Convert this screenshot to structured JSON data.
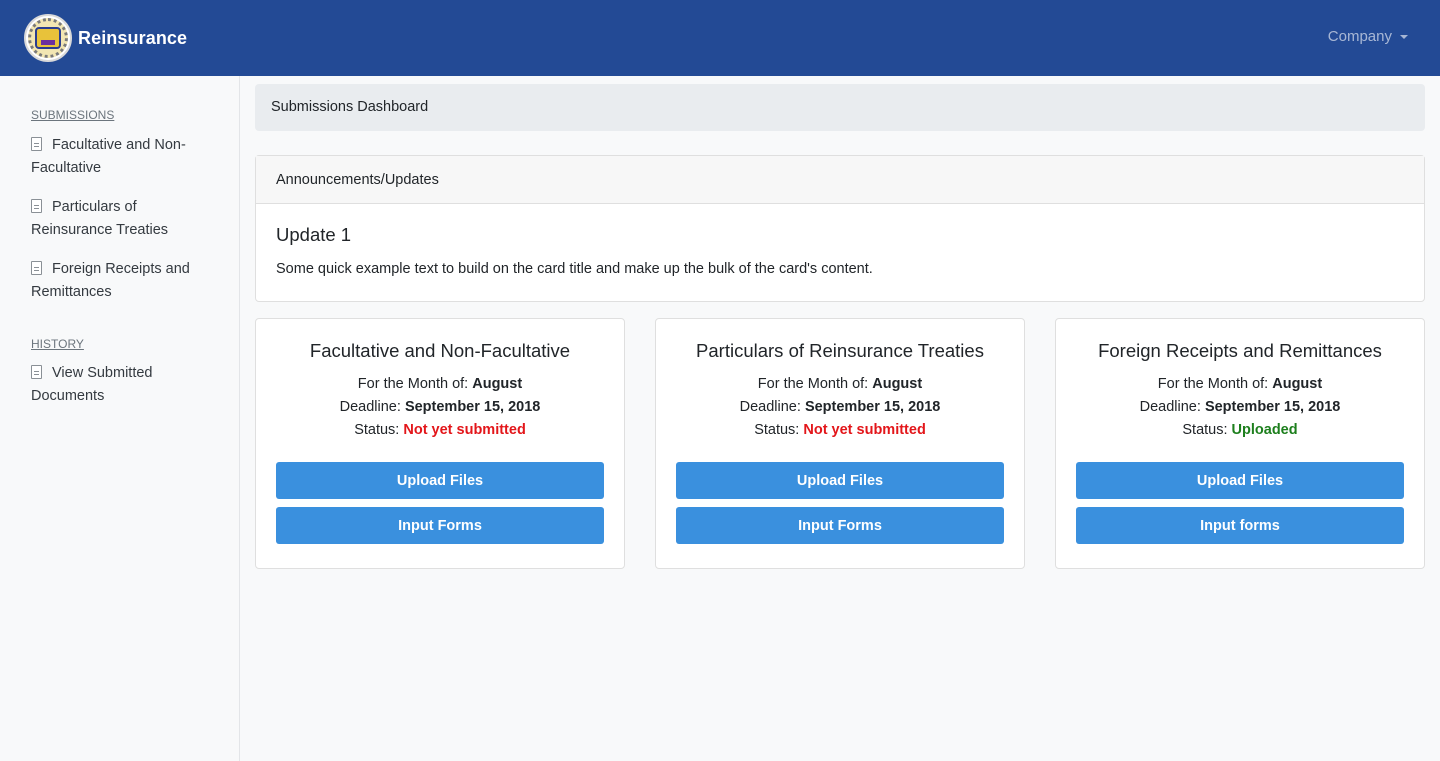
{
  "navbar": {
    "brand": "Reinsurance",
    "logo_icon": "seal-logo",
    "company_menu": "Company",
    "background": "#234a95"
  },
  "sidebar": {
    "sections": [
      {
        "heading": "SUBMISSIONS",
        "items": [
          {
            "label": "Facultative and Non-Facultative",
            "icon": "document-icon"
          },
          {
            "label": "Particulars of Reinsurance Treaties",
            "icon": "document-icon"
          },
          {
            "label": "Foreign Receipts and Remittances",
            "icon": "document-icon"
          }
        ]
      },
      {
        "heading": "HISTORY",
        "items": [
          {
            "label": "View Submitted Documents",
            "icon": "document-icon"
          }
        ]
      }
    ]
  },
  "breadcrumb": "Submissions Dashboard",
  "announcements": {
    "header": "Announcements/Updates",
    "title": "Update 1",
    "text": "Some quick example text to build on the card title and make up the bulk of the card's content."
  },
  "cards": [
    {
      "title": "Facultative and Non-Facultative",
      "month_label": "For the Month of: ",
      "month": "August",
      "deadline_label": "Deadline: ",
      "deadline": "September 15, 2018",
      "status_label": "Status: ",
      "status": "Not yet submitted",
      "status_color": "#e3161a",
      "upload_label": "Upload Files",
      "forms_label": "Input Forms"
    },
    {
      "title": "Particulars of Reinsurance Treaties",
      "month_label": "For the Month of: ",
      "month": "August",
      "deadline_label": "Deadline: ",
      "deadline": "September 15, 2018",
      "status_label": "Status: ",
      "status": "Not yet submitted",
      "status_color": "#e3161a",
      "upload_label": "Upload Files",
      "forms_label": "Input Forms"
    },
    {
      "title": "Foreign Receipts and Remittances",
      "month_label": "For the Month of: ",
      "month": "August",
      "deadline_label": "Deadline: ",
      "deadline": "September 15, 2018",
      "status_label": "Status: ",
      "status": "Uploaded",
      "status_color": "#1d7f1d",
      "upload_label": "Upload Files",
      "forms_label": "Input forms"
    }
  ],
  "colors": {
    "button": "#3a90de",
    "breadcrumb_bg": "#e9ecef"
  }
}
